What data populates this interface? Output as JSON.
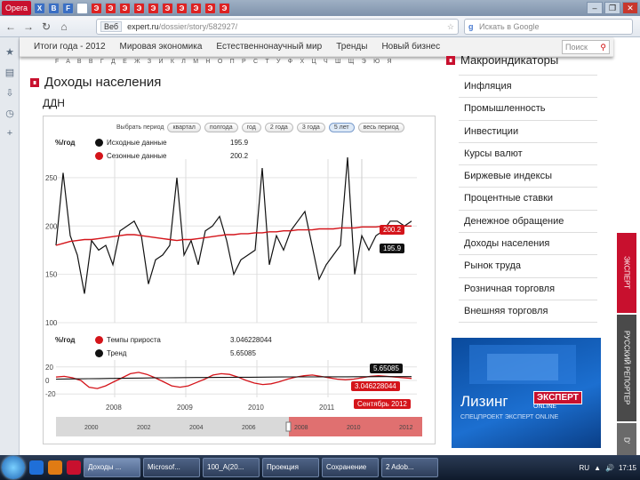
{
  "browser": {
    "menu_label": "Opera",
    "tab_letters": [
      "X",
      "B",
      "F",
      "Я",
      "Э",
      "Э",
      "Э",
      "Э",
      "Э",
      "Э",
      "Э",
      "Э",
      "Э",
      "Э"
    ],
    "window_controls": [
      "–",
      "❐",
      "✕"
    ],
    "nav_icons": [
      "←",
      "→",
      "↻",
      "⌂"
    ],
    "address_badge": "Веб",
    "address_domain": "expert.ru",
    "address_path": "/dossier/story/582927/",
    "search_placeholder": "Искать в Google"
  },
  "site_nav": {
    "items": [
      "Итоги года - 2012",
      "Мировая экономика",
      "Естественнонаучный мир",
      "Тренды",
      "Новый бизнес"
    ],
    "search_placeholder": "Поиск",
    "alphabet": "F A B В Г Д Е Ж З И К Л М Н О П Р С Т У Ф Х Ц Ч Ш Щ Э Ю Я"
  },
  "page": {
    "title": "Доходы населения",
    "subtitle": "ДДН"
  },
  "chart_panel": {
    "period_label": "Выбрать период",
    "period_buttons": [
      "квартал",
      "полгода",
      "год",
      "2 года",
      "3 года",
      "5 лет",
      "весь период"
    ],
    "selected_period": "5 лет",
    "unit_top": "%/год",
    "legend_top": [
      {
        "name": "Исходные данные",
        "value": "195.9",
        "color": "#111111"
      },
      {
        "name": "Сезонные данные",
        "value": "200.2",
        "color": "#d4141a"
      }
    ],
    "unit_bottom": "%/год",
    "legend_bottom": [
      {
        "name": "Темпы прироста",
        "value": "3.046228044",
        "color": "#d4141a"
      },
      {
        "name": "Тренд",
        "value": "5.65085",
        "color": "#111111"
      }
    ],
    "tag_red_top": "200.2",
    "tag_black_top": "195.9",
    "tag_black_bottom": "5.65085",
    "tag_red_bottom": "3.046228044",
    "date_tag": "Сентябрь 2012",
    "navigator_years": [
      "2000",
      "2002",
      "2004",
      "2006",
      "2008",
      "2010",
      "2012"
    ]
  },
  "chart_data": {
    "type": "line",
    "title": "",
    "x_ticks": [
      "2008",
      "2009",
      "2010",
      "2011"
    ],
    "y_ticks_top": [
      100,
      150,
      200,
      250
    ],
    "y_ticks_bottom": [
      20,
      0,
      -20
    ],
    "ylim_top": [
      100,
      260
    ],
    "ylim_bottom": [
      -25,
      25
    ],
    "x_range": [
      "2007-06",
      "2012-09"
    ],
    "series_top": [
      {
        "name": "Исходные данные",
        "color": "#111111",
        "values": [
          180,
          255,
          190,
          170,
          130,
          185,
          175,
          180,
          160,
          195,
          200,
          205,
          190,
          140,
          165,
          170,
          180,
          250,
          170,
          185,
          160,
          195,
          200,
          210,
          185,
          150,
          165,
          170,
          175,
          260,
          160,
          190,
          175,
          195,
          205,
          215,
          180,
          145,
          160,
          170,
          180,
          280,
          150,
          190,
          175,
          190,
          195,
          205,
          205,
          200,
          205
        ]
      },
      {
        "name": "Сезонные данные",
        "color": "#d4141a",
        "values": [
          180,
          182,
          184,
          185,
          186,
          186,
          187,
          188,
          189,
          190,
          191,
          191,
          190,
          189,
          188,
          187,
          186,
          185,
          186,
          186,
          187,
          188,
          189,
          190,
          191,
          191,
          192,
          192,
          193,
          193,
          194,
          194,
          195,
          195,
          196,
          196,
          196,
          197,
          197,
          197,
          198,
          198,
          198,
          199,
          199,
          199,
          200,
          200,
          200,
          200,
          200
        ]
      }
    ],
    "series_bottom": [
      {
        "name": "Темпы прироста",
        "color": "#d4141a",
        "values": [
          5,
          6,
          4,
          0,
          -10,
          -12,
          -8,
          -2,
          4,
          10,
          12,
          9,
          4,
          -2,
          -8,
          -10,
          -8,
          -3,
          2,
          8,
          10,
          9,
          5,
          0,
          -4,
          -6,
          -5,
          -2,
          2,
          5,
          7,
          8,
          6,
          4,
          2,
          1,
          2,
          4,
          6,
          7,
          6,
          5,
          4,
          3
        ]
      },
      {
        "name": "Тренд",
        "color": "#111111",
        "values": [
          2,
          2.2,
          2.4,
          2.6,
          2.8,
          3,
          3.2,
          3.4,
          3.6,
          3.8,
          4,
          4.1,
          4.2,
          4.3,
          4.4,
          4.5,
          4.6,
          4.7,
          4.8,
          4.9,
          5,
          5.1,
          5.2,
          5.25,
          5.3,
          5.35,
          5.4,
          5.45,
          5.5,
          5.55,
          5.6,
          5.62,
          5.64,
          5.65
        ]
      }
    ],
    "grid": true
  },
  "sidebar": {
    "title": "Макроиндикаторы",
    "items": [
      "Инфляция",
      "Промышленность",
      "Инвестиции",
      "Курсы валют",
      "Биржевые индексы",
      "Процентные ставки",
      "Денежное обращение",
      "Доходы населения",
      "Рынок труда",
      "Розничная торговля",
      "Внешняя торговля"
    ]
  },
  "ad": {
    "brand": "Лизинг",
    "logo": "ЭКСПЕРТ",
    "logo_sub": "ONLINE",
    "tagline": "СПЕЦПРОЕКТ ЭКСПЕРТ ONLINE"
  },
  "vertical_tabs": [
    {
      "label": "ЭКСПЕРТ",
      "color": "#c8102e"
    },
    {
      "label": "РУССКИЙ РЕПОРТЕР",
      "color": "#4a4a4a"
    },
    {
      "label": "D'",
      "color": "#6a6a6a"
    }
  ],
  "taskbar": {
    "tasks": [
      "Доходы ...",
      "Microsof...",
      "100_А(20...",
      "Проекция",
      "Сохранение",
      "2 Adob..."
    ],
    "active_index": 0,
    "tray": [
      "RU",
      "▲",
      "🔊",
      "17:15"
    ]
  }
}
